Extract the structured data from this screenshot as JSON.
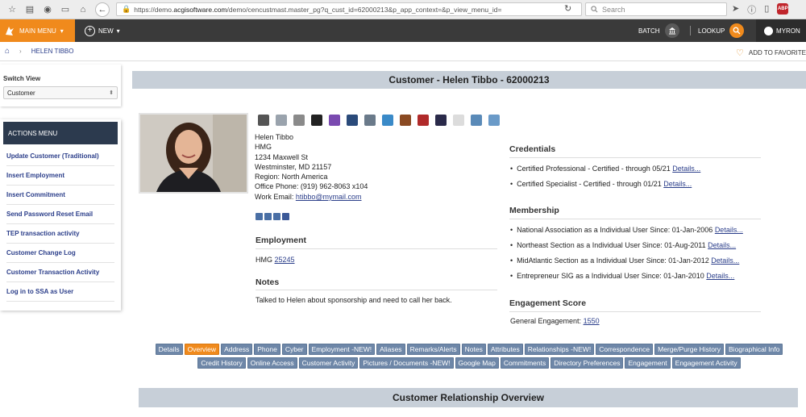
{
  "browser": {
    "url_prefix": "https://demo.",
    "url_domain": "acgisoftware.com",
    "url_rest": "/demo/cencustmast.master_pg?q_cust_id=62000213&p_app_context=&p_view_menu_id=",
    "search_placeholder": "Search"
  },
  "appbar": {
    "main_menu": "MAIN MENU",
    "new": "NEW",
    "batch": "BATCH",
    "lookup": "LOOKUP",
    "user": "MYRON",
    "accent": "#f08a1c"
  },
  "breadcrumb": {
    "current": "HELEN TIBBO",
    "add_favorite": "ADD TO FAVORITE"
  },
  "switch_view": {
    "label": "Switch View",
    "value": "Customer"
  },
  "actions_menu": {
    "title": "ACTIONS MENU",
    "items": [
      "Update Customer (Traditional)",
      "Insert Employment",
      "Insert Commitment",
      "Send Password Reset Email",
      "TEP transaction activity",
      "Customer Change Log",
      "Customer Transaction Activity",
      "Log in to SSA as User"
    ]
  },
  "page_title": "Customer - Helen Tibbo - 62000213",
  "contact": {
    "name": "Helen Tibbo",
    "org": "HMG",
    "street": "1234 Maxwell St",
    "city": "Westminster, MD 21157",
    "region": "Region: North America",
    "phone": "Office Phone: (919) 962-8063 x104",
    "email_label": "Work Email: ",
    "email": "htibbo@mymail.com"
  },
  "employment": {
    "heading": "Employment",
    "org": "HMG ",
    "id": "25245"
  },
  "notes": {
    "heading": "Notes",
    "text": "Talked to Helen about sponsorship and need to call her back."
  },
  "credentials": {
    "heading": "Credentials",
    "items": [
      {
        "text": "Certified Professional - Certified - through 05/21 ",
        "link": "Details..."
      },
      {
        "text": "Certified Specialist - Certified - through 01/21 ",
        "link": "Details..."
      }
    ]
  },
  "membership": {
    "heading": "Membership",
    "items": [
      {
        "text": "National Association as a Individual User Since: 01-Jan-2006 ",
        "link": "Details..."
      },
      {
        "text": "Northeast Section as a Individual User Since: 01-Aug-2011 ",
        "link": "Details..."
      },
      {
        "text": "MidAtlantic Section as a Individual User Since: 01-Jan-2012 ",
        "link": "Details..."
      },
      {
        "text": "Entrepreneur SIG as a Individual User Since: 01-Jan-2010 ",
        "link": "Details..."
      }
    ]
  },
  "engagement": {
    "heading": "Engagement Score",
    "label": "General Engagement: ",
    "value": "1550"
  },
  "tabs_row1": [
    "Details",
    "Overview",
    "Address",
    "Phone",
    "Cyber",
    "Employment -NEW!",
    "Aliases",
    "Remarks/Alerts",
    "Notes",
    "Attributes",
    "Relationships -NEW!",
    "Correspondence",
    "Merge/Purge History",
    "Biographical Info"
  ],
  "tabs_row2": [
    "Credit History",
    "Online Access",
    "Customer Activity",
    "Pictures / Documents -NEW!",
    "Google Map",
    "Commitments",
    "Directory Preferences",
    "Engagement",
    "Engagement Activity"
  ],
  "active_tab": "Overview",
  "overview_title": "Customer Relationship Overview"
}
